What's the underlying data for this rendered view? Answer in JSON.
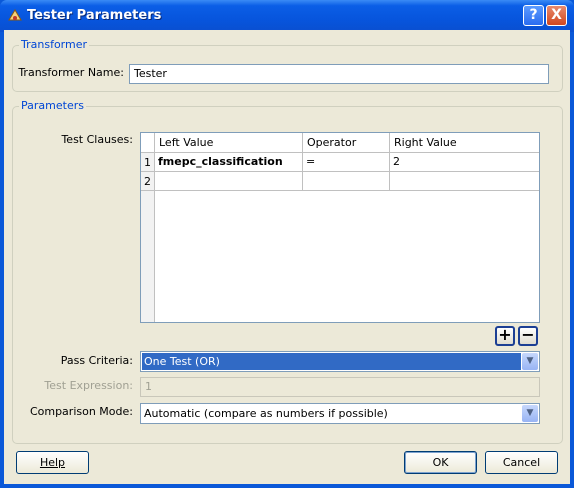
{
  "window": {
    "title": "Tester Parameters",
    "help_button": "?",
    "close_button": "X"
  },
  "transformer": {
    "legend": "Transformer",
    "name_label": "Transformer Name:",
    "name_value": "Tester"
  },
  "parameters": {
    "legend": "Parameters",
    "test_clauses_label": "Test Clauses:",
    "columns": [
      "Left Value",
      "Operator",
      "Right Value"
    ],
    "rows": [
      {
        "num": "1",
        "left": "fmepc_classification",
        "op": "=",
        "right": "2"
      },
      {
        "num": "2",
        "left": "",
        "op": "",
        "right": ""
      }
    ],
    "add_label": "+",
    "remove_label": "−",
    "pass_criteria_label": "Pass Criteria:",
    "pass_criteria_value": "One Test (OR)",
    "test_expression_label": "Test Expression:",
    "test_expression_value": "1",
    "comparison_mode_label": "Comparison Mode:",
    "comparison_mode_value": "Automatic (compare as numbers if possible)"
  },
  "buttons": {
    "help": "Help",
    "ok": "OK",
    "cancel": "Cancel"
  }
}
